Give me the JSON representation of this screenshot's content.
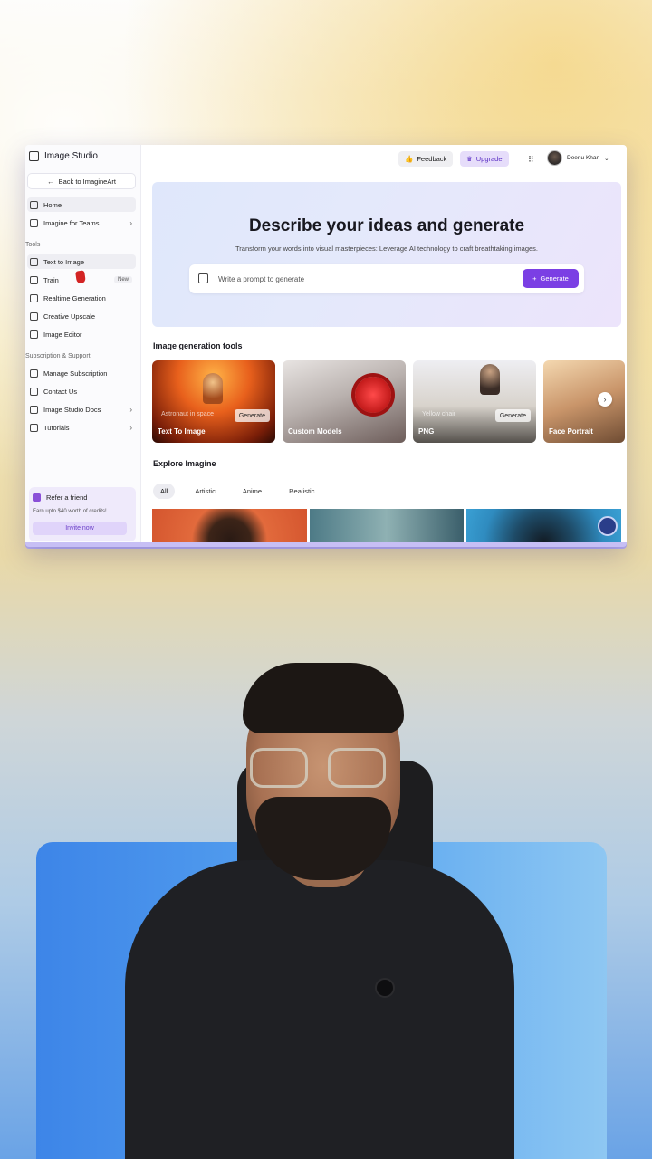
{
  "sidebar": {
    "brand": "Image Studio",
    "back_button": "Back to ImagineArt",
    "top_items": [
      {
        "label": "Home"
      },
      {
        "label": "Imagine for Teams"
      }
    ],
    "tools_label": "Tools",
    "tools": [
      {
        "label": "Text to Image"
      },
      {
        "label": "Train",
        "badge": "New"
      },
      {
        "label": "Realtime Generation"
      },
      {
        "label": "Creative Upscale"
      },
      {
        "label": "Image Editor"
      }
    ],
    "support_label": "Subscription & Support",
    "support": [
      {
        "label": "Manage Subscription"
      },
      {
        "label": "Contact Us"
      },
      {
        "label": "Image Studio Docs"
      },
      {
        "label": "Tutorials"
      }
    ],
    "refer": {
      "title": "Refer a friend",
      "subtitle": "Earn upto $40 worth of credits!",
      "button": "Invite now"
    }
  },
  "topbar": {
    "feedback": "Feedback",
    "upgrade": "Upgrade",
    "user_name": "Deenu Khan"
  },
  "hero": {
    "title": "Describe your ideas and generate",
    "subtitle": "Transform your words into visual masterpieces: Leverage AI technology to craft breathtaking images.",
    "prompt_placeholder": "Write a prompt to generate",
    "generate_button": "Generate"
  },
  "tools_section": {
    "title": "Image generation tools",
    "cards": [
      {
        "label": "Text To Image",
        "mini_prompt": "Astronaut in space",
        "mini_button": "Generate"
      },
      {
        "label": "Custom Models"
      },
      {
        "label": "PNG",
        "mini_prompt": "Yellow chair",
        "mini_button": "Generate"
      },
      {
        "label": "Face Portrait"
      }
    ]
  },
  "explore": {
    "title": "Explore Imagine",
    "filters": [
      "All",
      "Artistic",
      "Anime",
      "Realistic"
    ],
    "selected_filter": "All"
  },
  "colors": {
    "accent": "#7b3fe4",
    "upgrade_bg": "#e6ddfa"
  }
}
